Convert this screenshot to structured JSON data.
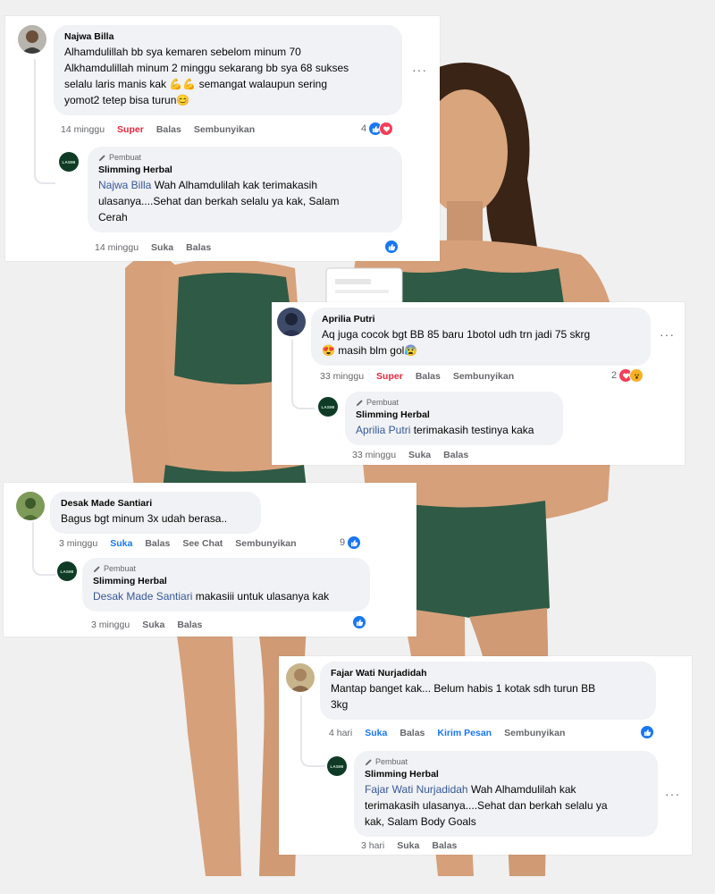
{
  "comments": [
    {
      "author": "Najwa Billa",
      "text_lines": [
        "Alhamdulillah bb sya kemaren sebelom minum 70",
        "Alkhamdulillah minum 2 minggu sekarang bb sya 68 sukses",
        "selalu laris manis kak 💪💪 semangat walaupun sering",
        "yomot2 tetep bisa turun😊"
      ],
      "time": "14 minggu",
      "reaction_label": "Super",
      "reply_label": "Balas",
      "hide_label": "Sembunyikan",
      "reaction_count": "4",
      "reply": {
        "creator_label": "Pembuat",
        "author": "Slimming Herbal",
        "tag": "Najwa Billa",
        "text_lines": [
          " Wah Alhamdulilah kak terimakasih",
          "ulasanya....Sehat dan berkah selalu ya kak, Salam",
          "Cerah"
        ],
        "time": "14 minggu",
        "like_label": "Suka",
        "reply_label": "Balas"
      }
    },
    {
      "author": "Aprilia Putri",
      "text_lines": [
        "Aq juga cocok bgt BB 85 baru 1botol udh trn jadi 75 skrg",
        "😍 masih blm gol😰"
      ],
      "time": "33 minggu",
      "reaction_label": "Super",
      "reply_label": "Balas",
      "hide_label": "Sembunyikan",
      "reaction_count": "2",
      "reply": {
        "creator_label": "Pembuat",
        "author": "Slimming Herbal",
        "tag": "Aprilia Putri",
        "text_lines": [
          " terimakasih testinya kaka"
        ],
        "time": "33 minggu",
        "like_label": "Suka",
        "reply_label": "Balas"
      }
    },
    {
      "author": "Desak Made Santiari",
      "text_lines": [
        "Bagus bgt minum 3x udah berasa.."
      ],
      "time": "3 minggu",
      "like_label": "Suka",
      "reply_label": "Balas",
      "chat_label": "See Chat",
      "hide_label": "Sembunyikan",
      "reaction_count": "9",
      "reply": {
        "creator_label": "Pembuat",
        "author": "Slimming Herbal",
        "tag": "Desak Made Santiari",
        "text_lines": [
          " makasiii untuk ulasanya kak"
        ],
        "time": "3 minggu",
        "like_label": "Suka",
        "reply_label": "Balas"
      }
    },
    {
      "author": "Fajar Wati Nurjadidah",
      "text_lines": [
        "Mantap banget kak... Belum habis 1 kotak sdh turun BB",
        "3kg"
      ],
      "time": "4 hari",
      "like_label": "Suka",
      "reply_label": "Balas",
      "message_label": "Kirim Pesan",
      "hide_label": "Sembunyikan",
      "reply": {
        "creator_label": "Pembuat",
        "author": "Slimming Herbal",
        "tag": "Fajar Wati Nurjadidah",
        "text_lines": [
          " Wah Alhamdulilah kak",
          "terimakasih ulasanya....Sehat dan berkah selalu ya",
          "kak, Salam Body Goals"
        ],
        "time": "3 hari",
        "like_label": "Suka",
        "reply_label": "Balas"
      }
    }
  ],
  "brand_avatar_text": "LASMI",
  "colors": {
    "accent": "#1877f2",
    "super": "#e4283e",
    "bubble": "#f0f2f5",
    "outfit": "#2f5a45"
  }
}
